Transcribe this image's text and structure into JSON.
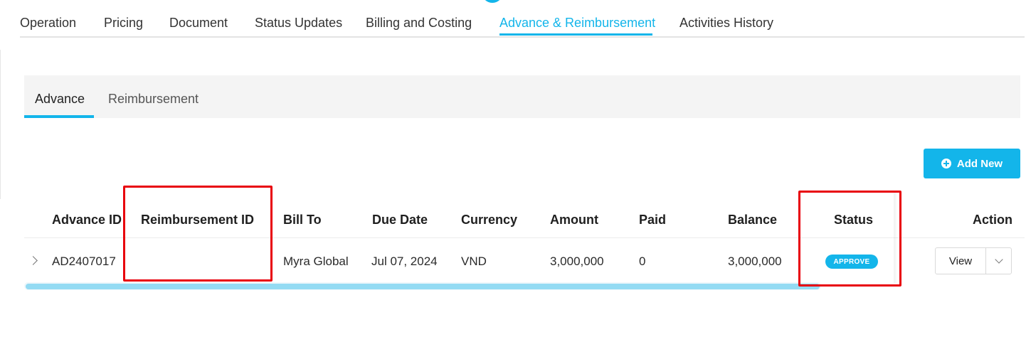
{
  "top_tabs": [
    {
      "label": "Operation"
    },
    {
      "label": "Pricing"
    },
    {
      "label": "Document"
    },
    {
      "label": "Status Updates"
    },
    {
      "label": "Billing and Costing"
    },
    {
      "label": "Advance & Reimbursement",
      "active": true
    },
    {
      "label": "Activities History"
    }
  ],
  "sub_tabs": [
    {
      "label": "Advance",
      "active": true
    },
    {
      "label": "Reimbursement"
    }
  ],
  "add_button": {
    "label": "Add New",
    "icon": "plus-circle-icon"
  },
  "table": {
    "columns": [
      "Advance ID",
      "Reimbursement ID",
      "Bill To",
      "Due Date",
      "Currency",
      "Amount",
      "Paid",
      "Balance",
      "Status",
      "Action"
    ],
    "rows": [
      {
        "advance_id": "AD2407017",
        "reimbursement_id": "",
        "bill_to": "Myra Global",
        "due_date": "Jul 07, 2024",
        "currency": "VND",
        "amount": "3,000,000",
        "paid": "0",
        "balance": "3,000,000",
        "status": "APPROVE",
        "action_label": "View"
      }
    ]
  },
  "colors": {
    "accent": "#13b5ea",
    "highlight": "#e8000b",
    "subtab_background": "#f4f4f4"
  }
}
